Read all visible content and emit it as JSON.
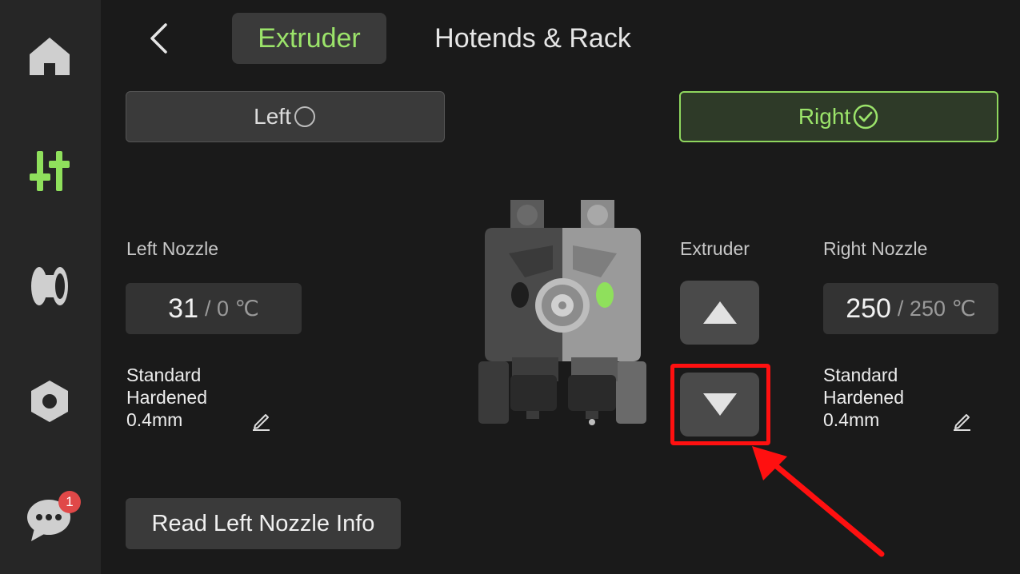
{
  "sidebar": {
    "items": [
      {
        "icon": "home-icon"
      },
      {
        "icon": "controls-icon",
        "active": true
      },
      {
        "icon": "filament-icon"
      },
      {
        "icon": "settings-icon"
      },
      {
        "icon": "messages-icon",
        "badge": "1"
      }
    ]
  },
  "header": {
    "tabs": [
      {
        "label": "Extruder",
        "active": true
      },
      {
        "label": "Hotends & Rack",
        "active": false
      }
    ]
  },
  "selector": {
    "left_label": "Left",
    "right_label": "Right",
    "selected": "Right"
  },
  "left_nozzle": {
    "title": "Left Nozzle",
    "current_temp": "31",
    "target_temp": "/ 0 ℃",
    "type_line1": "Standard",
    "type_line2": "Hardened",
    "diameter": "0.4mm"
  },
  "extruder": {
    "title": "Extruder"
  },
  "right_nozzle": {
    "title": "Right Nozzle",
    "current_temp": "250",
    "target_temp": "/ 250 ℃",
    "type_line1": "Standard",
    "type_line2": "Hardened",
    "diameter": "0.4mm"
  },
  "read_button_label": "Read Left Nozzle Info",
  "colors": {
    "accent": "#9be36a",
    "highlight": "#ff1010",
    "badge": "#e04848"
  }
}
